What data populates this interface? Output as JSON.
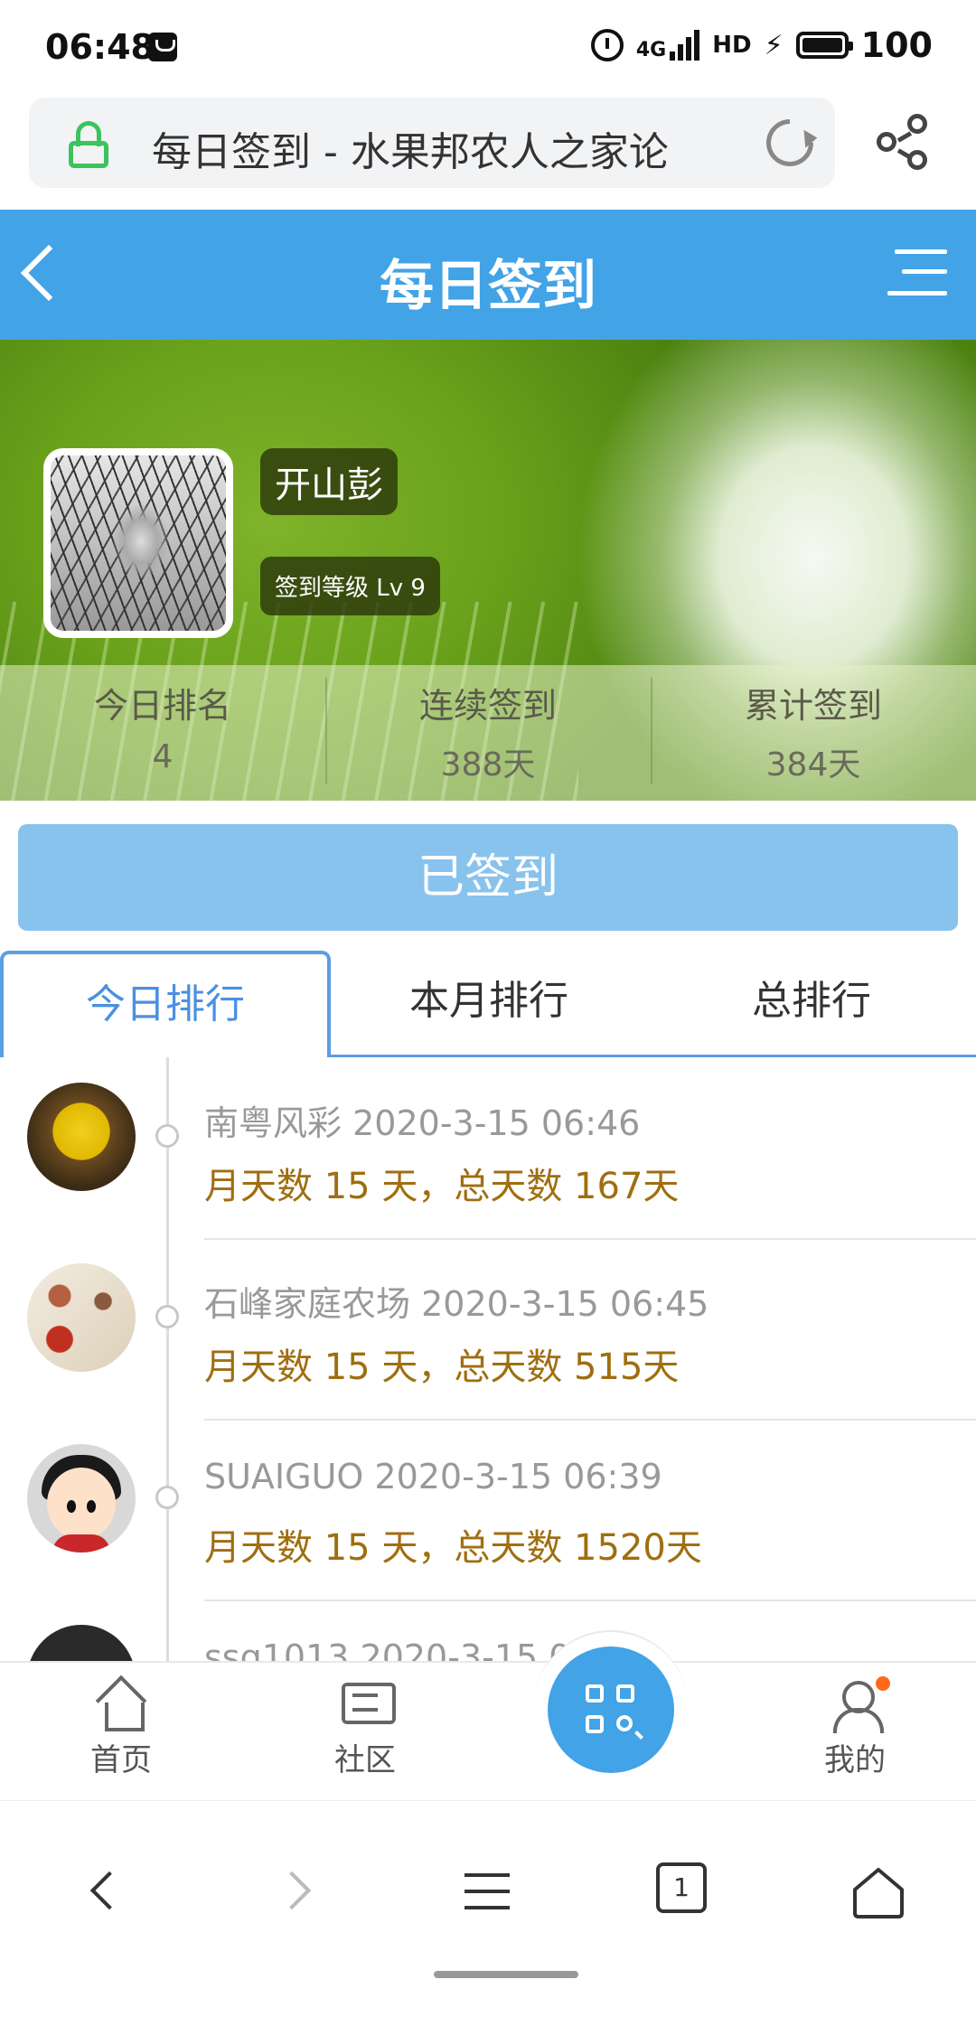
{
  "status_bar": {
    "time": "06:48",
    "network": "4G",
    "hd": "HD",
    "battery": "100"
  },
  "browser": {
    "address_text": "每日签到 - 水果邦农人之家论",
    "tab_count": "1"
  },
  "header": {
    "title": "每日签到"
  },
  "profile": {
    "username": "开山彭",
    "level": "签到等级 Lv 9",
    "stats": [
      {
        "label": "今日排名",
        "value": "4"
      },
      {
        "label": "连续签到",
        "value": "388天"
      },
      {
        "label": "累计签到",
        "value": "384天"
      }
    ]
  },
  "signed_button": "已签到",
  "tabs": [
    {
      "label": "今日排行",
      "active": true
    },
    {
      "label": "本月排行",
      "active": false
    },
    {
      "label": "总排行",
      "active": false
    }
  ],
  "rankings": [
    {
      "name": "南粤风彩",
      "time": "2020-3-15 06:46",
      "detail": "月天数 15 天，总天数 167天"
    },
    {
      "name": "石峰家庭农场",
      "time": "2020-3-15 06:45",
      "detail": "月天数 15 天，总天数 515天"
    },
    {
      "name": "SUAIGUO",
      "time": "2020-3-15 06:39",
      "detail": "月天数 15 天，总天数 1520天"
    },
    {
      "name": "ssq1013",
      "time": "2020-3-15 0",
      "detail": ""
    }
  ],
  "app_nav": {
    "home": "首页",
    "community": "社区",
    "mine": "我的"
  },
  "colors": {
    "primary": "#42a3e6",
    "signed_button": "#88c3ed",
    "detail_text": "#a06e10",
    "notification": "#ff6a1a"
  }
}
